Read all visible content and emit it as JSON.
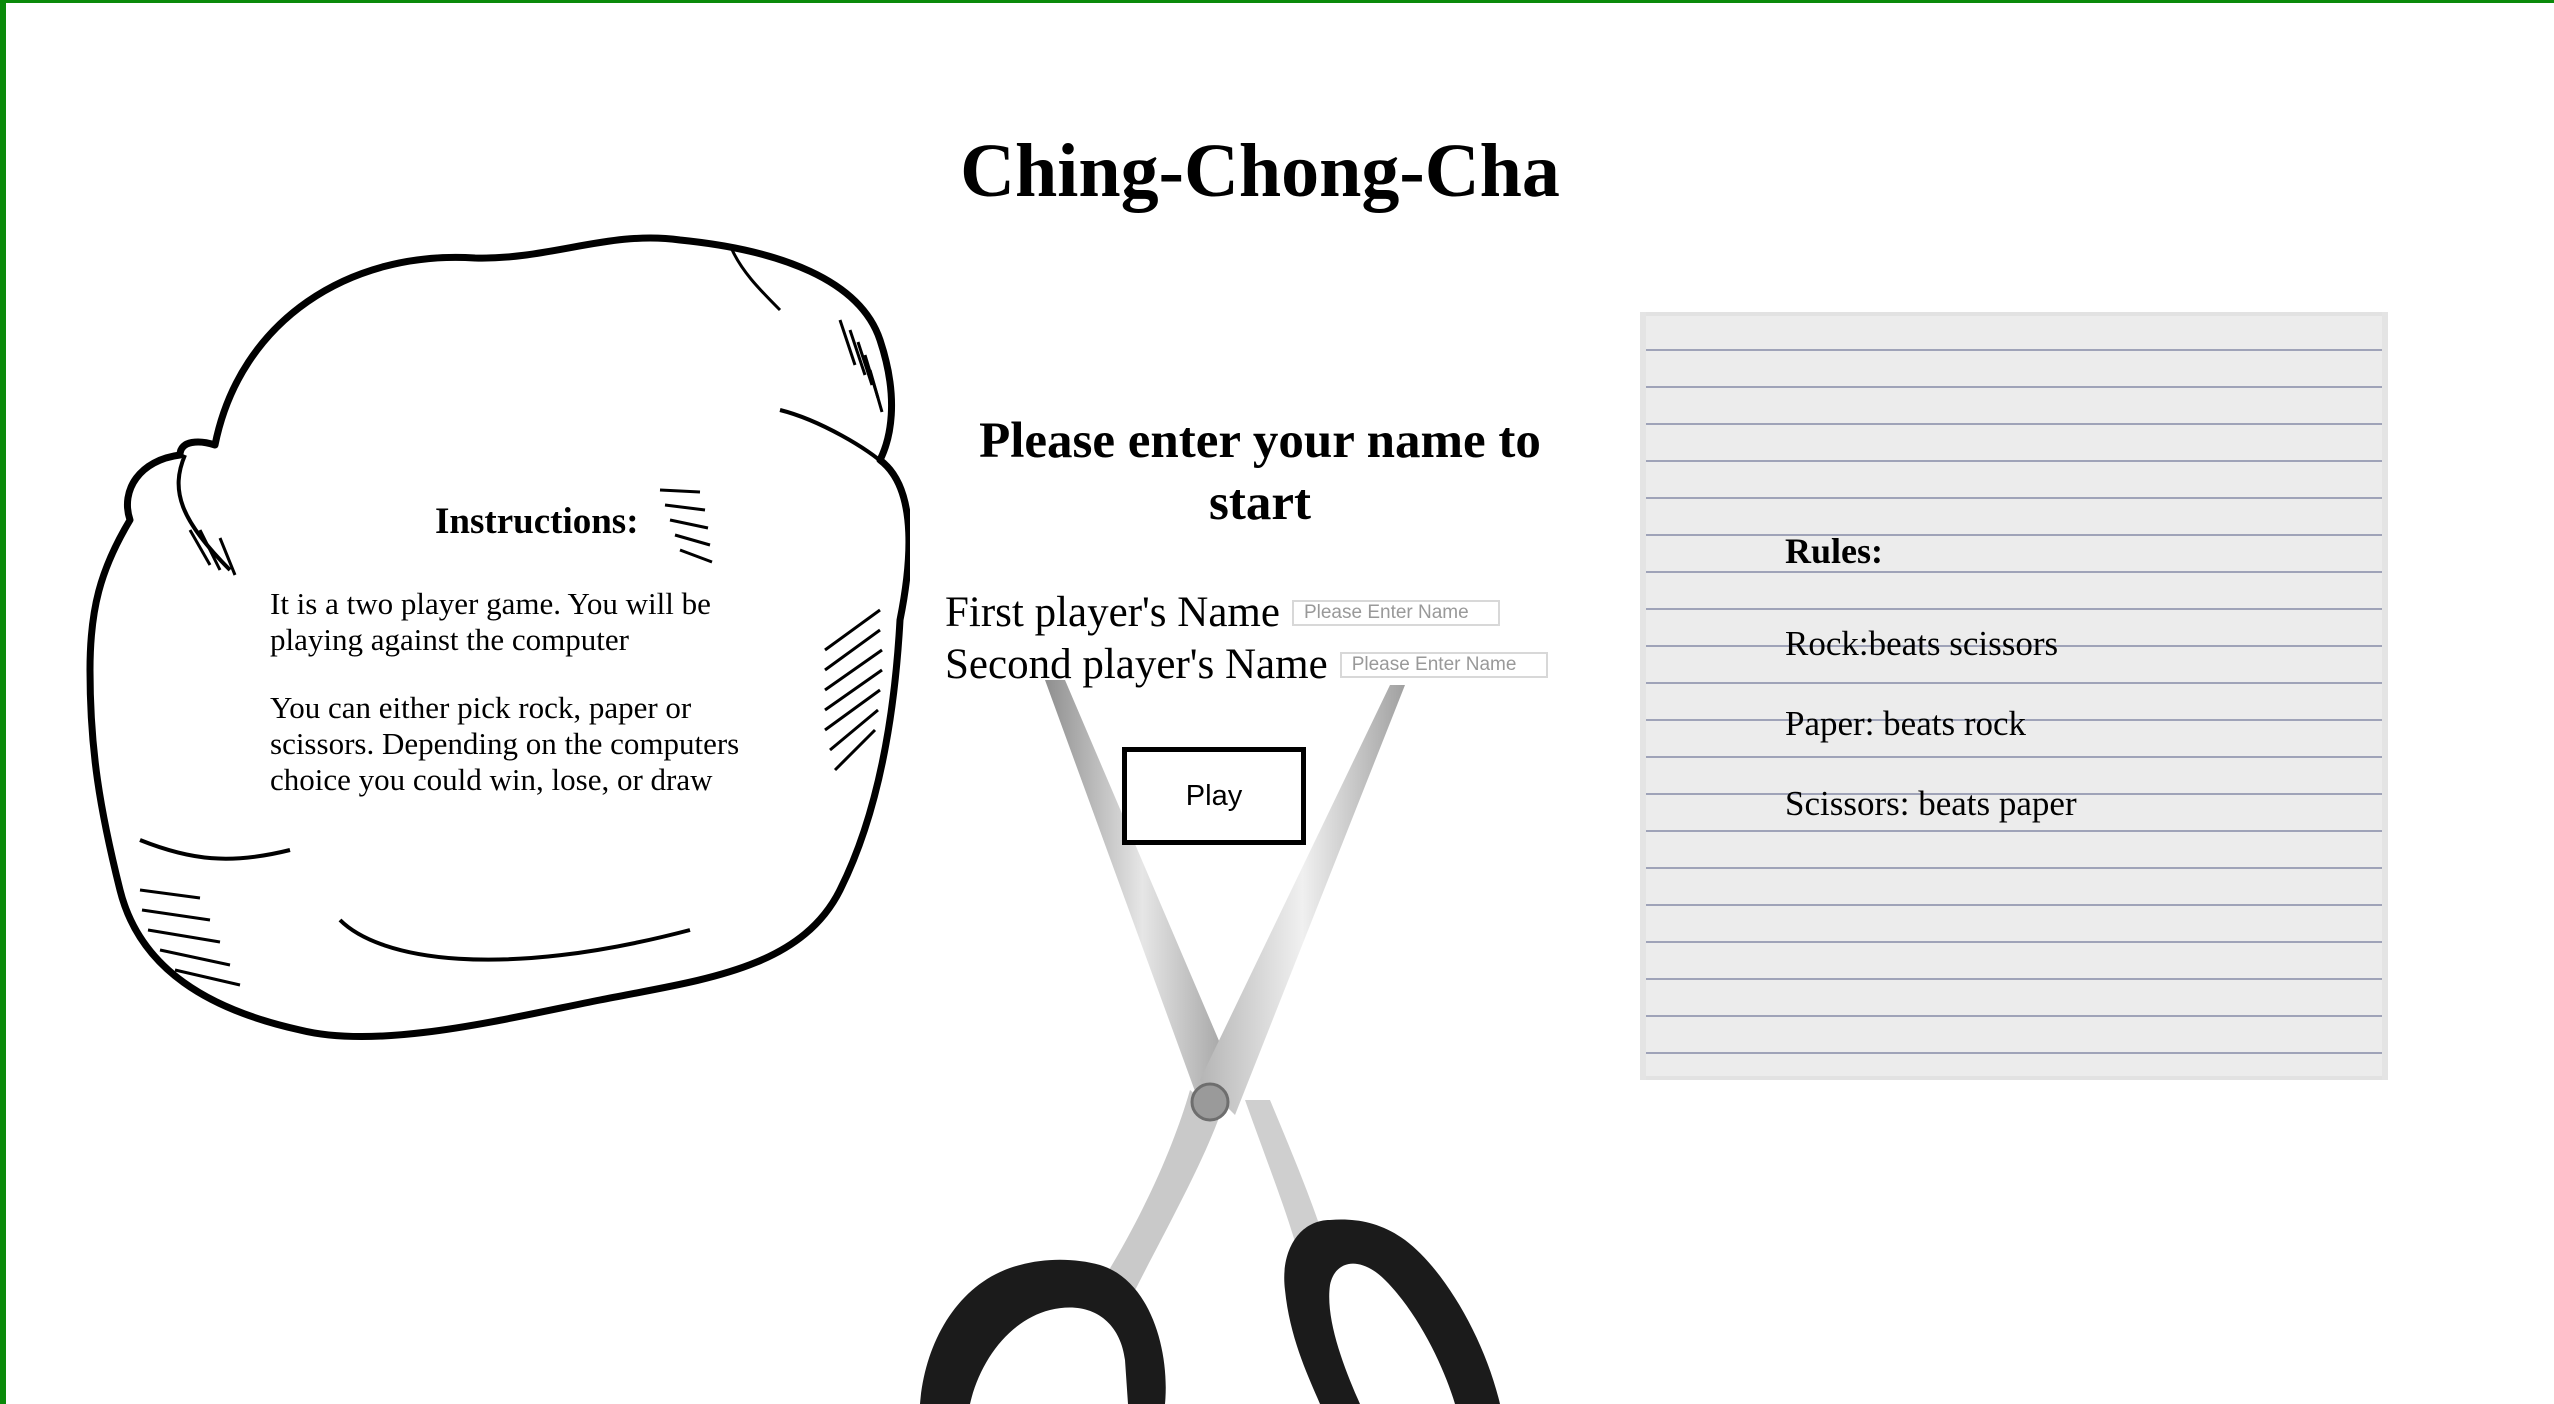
{
  "page": {
    "title": "Ching-Chong-Cha"
  },
  "instructions": {
    "title": "Instructions:",
    "paragraphs": [
      "It is a two player game. You will be playing against the computer",
      "You can either pick rock, paper or scissors. Depending on the computers choice you could win, lose, or draw"
    ]
  },
  "form": {
    "prompt": "Please enter your name to start",
    "first_label": "First player's Name",
    "first_placeholder": "Please Enter Name",
    "first_value": "",
    "second_label": "Second player's Name",
    "second_placeholder": "Please Enter Name",
    "second_value": "",
    "play_label": "Play"
  },
  "rules": {
    "title": "Rules:",
    "items": [
      "Rock:beats scissors",
      "Paper: beats rock",
      "Scissors: beats paper"
    ]
  },
  "colors": {
    "frame_border": "#0a8a0a",
    "paper_background": "#ececec",
    "paper_lines": "#9fa3b8"
  },
  "illustrations": {
    "left": "rock-drawing",
    "center": "scissors-image",
    "right": "lined-paper"
  }
}
